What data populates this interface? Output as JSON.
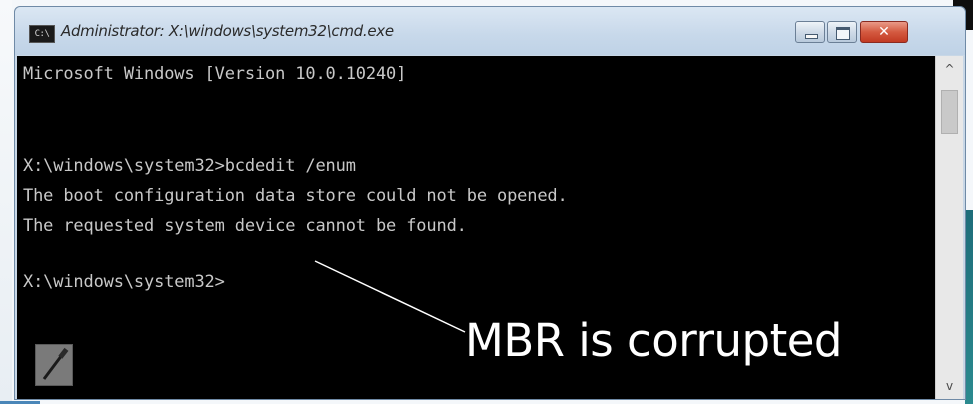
{
  "window": {
    "title": "Administrator: X:\\windows\\system32\\cmd.exe",
    "app_icon_text": "C:\\",
    "controls": {
      "minimize": "minimize-icon",
      "maximize": "maximize-icon",
      "close_label": "✕"
    }
  },
  "console": {
    "lines": [
      "Microsoft Windows [Version 10.0.10240]",
      "X:\\windows\\system32>bcdedit /enum",
      "The boot configuration data store could not be opened.",
      "The requested system device cannot be found.",
      "X:\\windows\\system32>"
    ],
    "background": "#000000",
    "text_color": "#c8c8c8"
  },
  "annotation": {
    "text": "MBR is corrupted",
    "color": "#ffffff"
  },
  "scrollbar": {
    "up_arrow": "^",
    "down_arrow": "v"
  },
  "colors": {
    "close_button": "#d45a40",
    "titlebar": "#c7d8ea"
  }
}
